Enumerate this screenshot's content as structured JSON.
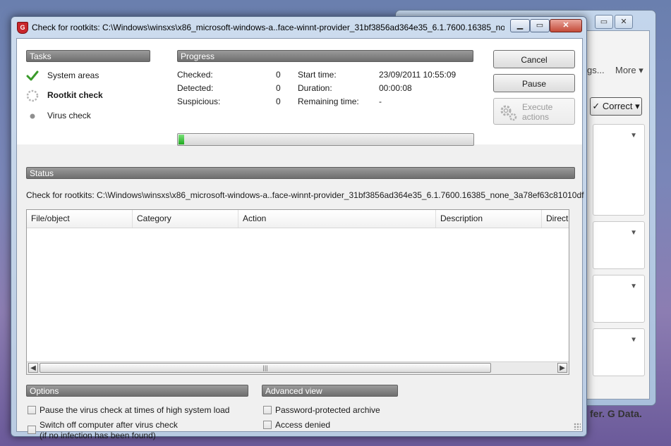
{
  "background_window": {
    "more_label": "More",
    "dots_label": "gs...",
    "correct_label": "Correct",
    "footer_text": "fer. G Data."
  },
  "window": {
    "title": "Check for rootkits: C:\\Windows\\winsxs\\x86_microsoft-windows-a..face-winnt-provider_31bf3856ad364e35_6.1.7600.16385_no..."
  },
  "tasks": {
    "header": "Tasks",
    "items": [
      {
        "label": "System areas",
        "state": "done"
      },
      {
        "label": "Rootkit check",
        "state": "running"
      },
      {
        "label": "Virus check",
        "state": "pending"
      }
    ]
  },
  "progress": {
    "header": "Progress",
    "checked_label": "Checked:",
    "checked_value": "0",
    "detected_label": "Detected:",
    "detected_value": "0",
    "suspicious_label": "Suspicious:",
    "suspicious_value": "0",
    "start_label": "Start time:",
    "start_value": "23/09/2011 10:55:09",
    "duration_label": "Duration:",
    "duration_value": "00:00:08",
    "remaining_label": "Remaining time:",
    "remaining_value": "-",
    "fraction": 0.02
  },
  "buttons": {
    "cancel": "Cancel",
    "pause": "Pause",
    "execute_line1": "Execute",
    "execute_line2": "actions"
  },
  "status": {
    "header": "Status",
    "text": "Check for rootkits: C:\\Windows\\winsxs\\x86_microsoft-windows-a..face-winnt-provider_31bf3856ad364e35_6.1.7600.16385_none_3a78ef63c81010df"
  },
  "table": {
    "columns": [
      "File/object",
      "Category",
      "Action",
      "Description",
      "Direct"
    ]
  },
  "options": {
    "header": "Options",
    "pause_label": "Pause the virus check at times of high system load",
    "switchoff_line1": "Switch off computer after virus check",
    "switchoff_line2": "(if no infection has been found)"
  },
  "advanced": {
    "header": "Advanced view",
    "password_label": "Password-protected archive",
    "access_label": "Access denied"
  },
  "colors": {
    "progress_fill": "#2db52d",
    "checkmark": "#3a9a2a",
    "header_bar": "#7f7f7f"
  }
}
